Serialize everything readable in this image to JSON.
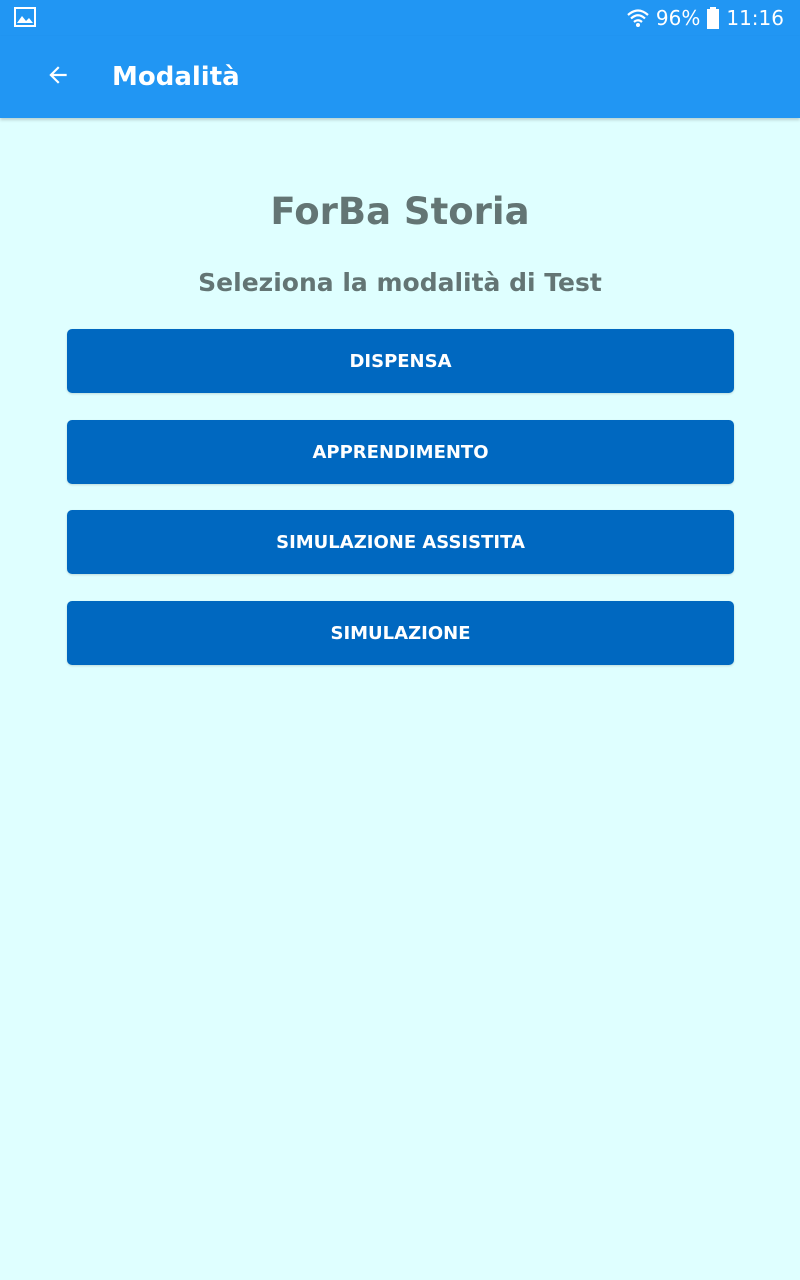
{
  "status_bar": {
    "battery_percent": "96%",
    "time": "11:16",
    "icons": [
      "image-notification-icon",
      "wifi-icon",
      "battery-icon"
    ]
  },
  "app_bar": {
    "title": "Modalità",
    "back_icon": "back-arrow-icon"
  },
  "main": {
    "title": "ForBa Storia",
    "subtitle": "Seleziona la modalità di Test",
    "buttons": [
      {
        "label": "DISPENSA"
      },
      {
        "label": "APPRENDIMENTO"
      },
      {
        "label": "SIMULAZIONE ASSISTITA"
      },
      {
        "label": "SIMULAZIONE"
      }
    ]
  },
  "colors": {
    "app_bar": "#2196f3",
    "background": "#dfffff",
    "button": "#0068c0",
    "heading_text": "#637574"
  }
}
